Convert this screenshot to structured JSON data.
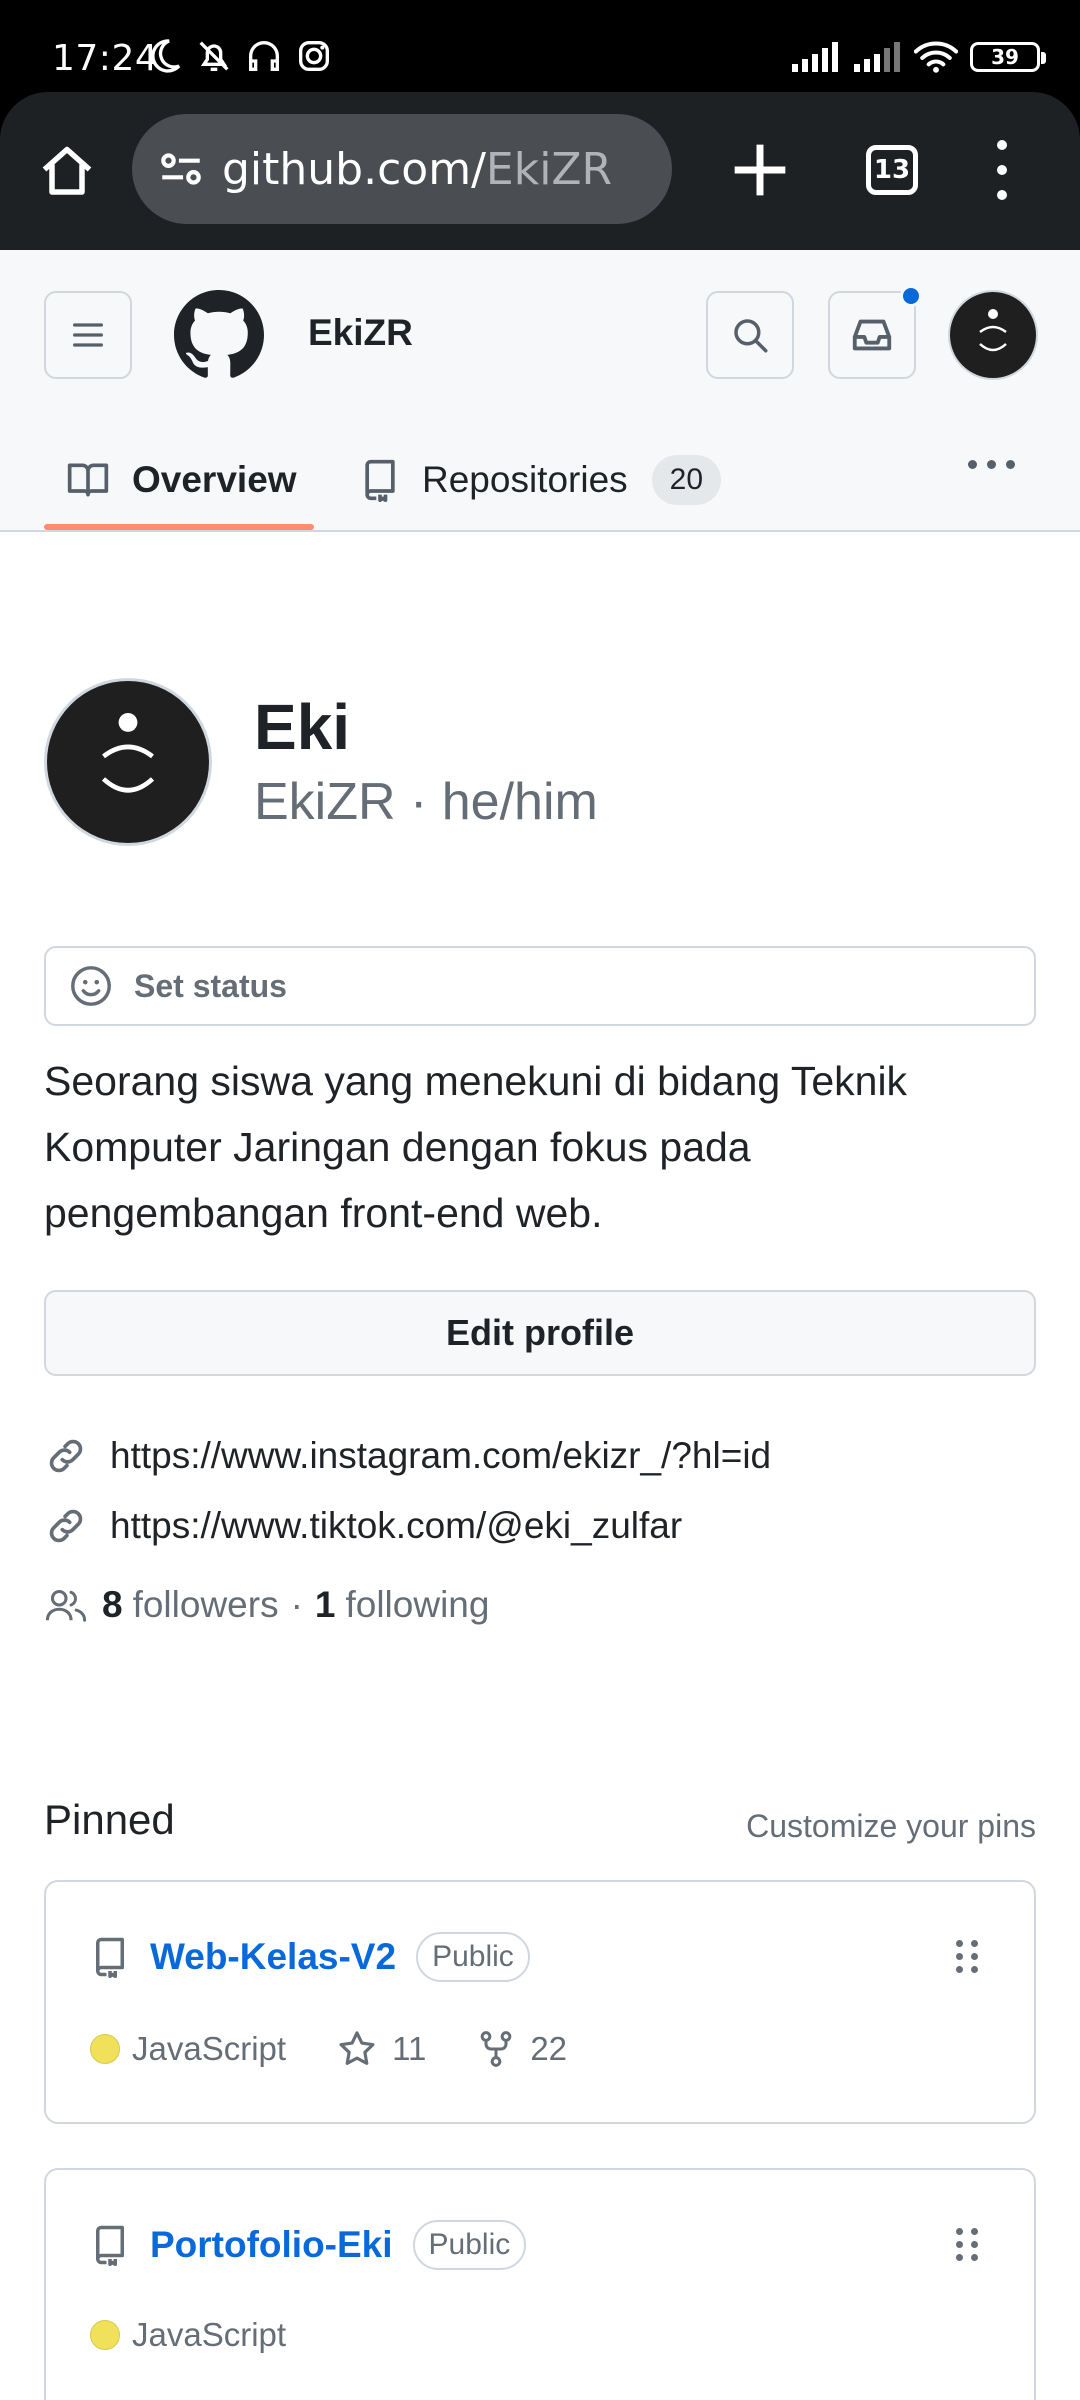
{
  "status_bar": {
    "time": "17:24",
    "battery": "39",
    "left_icons": [
      "moon-icon",
      "bell-off-icon",
      "headphones-icon",
      "instagram-icon"
    ],
    "right_icons": [
      "signal-icon",
      "signal-icon",
      "wifi-icon",
      "battery-icon"
    ]
  },
  "browser": {
    "url_host": "github.com/",
    "url_path": "EkiZR",
    "tab_count": "13"
  },
  "header": {
    "username": "EkiZR"
  },
  "tabs": [
    {
      "label": "Overview"
    },
    {
      "label": "Repositories",
      "count": "20"
    }
  ],
  "profile": {
    "name": "Eki",
    "login_line": "EkiZR · he/him",
    "set_status": "Set status",
    "bio": "Seorang siswa yang menekuni di bidang Teknik Komputer Jaringan dengan fokus pada pengembangan front-end web.",
    "edit_profile": "Edit profile",
    "links": [
      "https://www.instagram.com/ekizr_/?hl=id",
      "https://www.tiktok.com/@eki_zulfar"
    ],
    "followers_count": "8",
    "followers_label": "followers",
    "following_count": "1",
    "following_label": "following",
    "separator": "·"
  },
  "pinned": {
    "title": "Pinned",
    "customize": "Customize your pins",
    "repos": [
      {
        "name": "Web-Kelas-V2",
        "visibility": "Public",
        "language": "JavaScript",
        "stars": "11",
        "forks": "22"
      },
      {
        "name": "Portofolio-Eki",
        "visibility": "Public",
        "language": "JavaScript"
      }
    ]
  },
  "colors": {
    "link_blue": "#0969da",
    "tab_underline": "#fd8c73",
    "javascript": "#f1e05a",
    "notification": "#0969da"
  }
}
